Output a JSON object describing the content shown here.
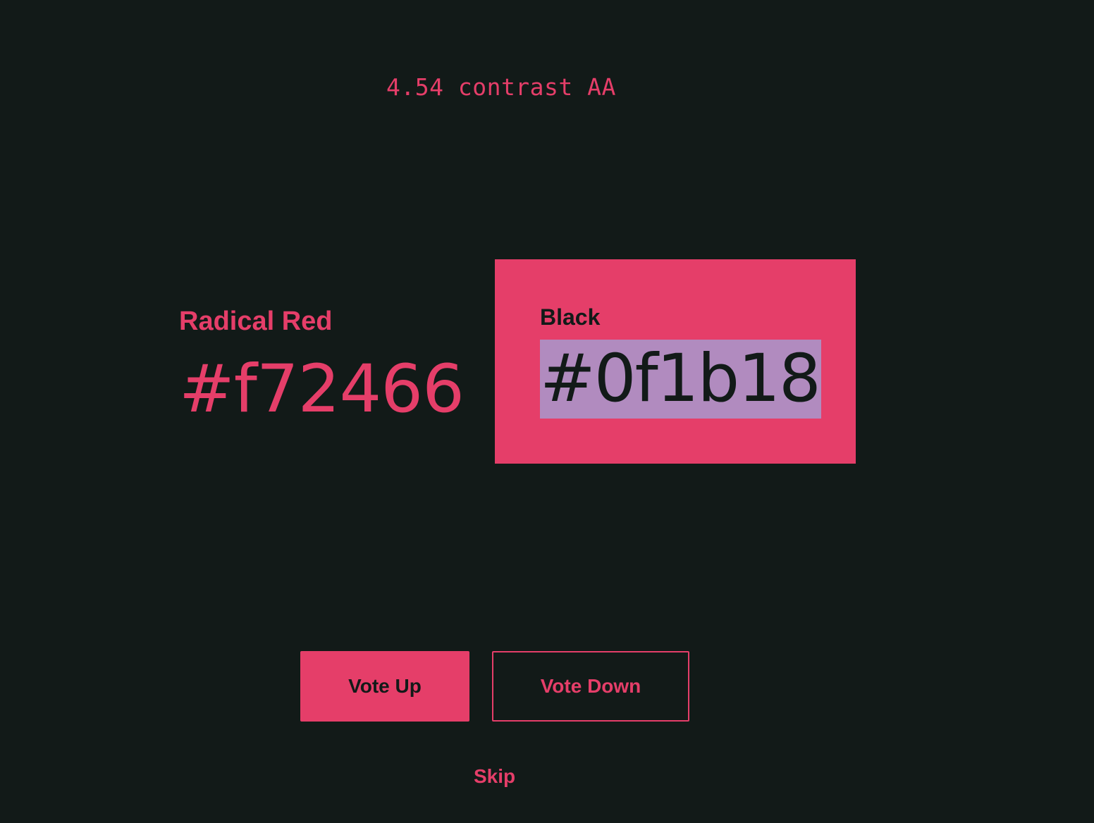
{
  "colors": {
    "page_background": "#121a18",
    "accent": "#e53e69",
    "selection_highlight": "#b18bbf"
  },
  "contrast": {
    "text": "4.54 contrast AA"
  },
  "foreground": {
    "name": "Radical Red",
    "hex": "#f72466"
  },
  "background": {
    "name": "Black",
    "hex": "#0f1b18"
  },
  "actions": {
    "vote_up_label": "Vote Up",
    "vote_down_label": "Vote Down",
    "skip_label": "Skip"
  }
}
